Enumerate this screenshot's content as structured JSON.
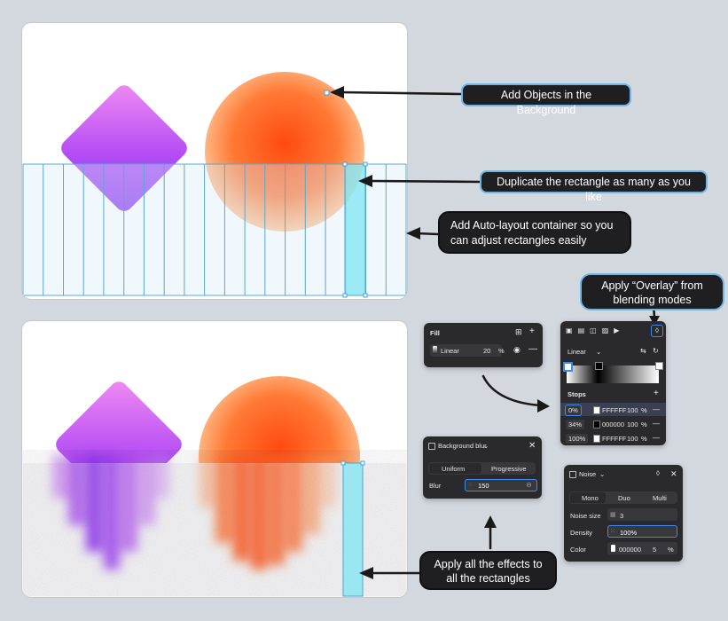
{
  "callouts": {
    "add_objects": "Add Objects in the Background",
    "duplicate": "Duplicate the rectangle as many as you like",
    "auto_layout": "Add Auto-layout container so you can adjust rectangles easily",
    "overlay": "Apply “Overlay” from blending modes",
    "apply_effects": "Apply all the effects to all the rectangles"
  },
  "fill_panel": {
    "title": "Fill",
    "type": "Linear",
    "opacity": "20",
    "unit": "%"
  },
  "gradient_panel": {
    "type": "Linear",
    "stops_title": "Stops",
    "stops": [
      {
        "pos": "0%",
        "hex": "FFFFFF",
        "opacity": "100",
        "unit": "%",
        "swatch": "#ffffff"
      },
      {
        "pos": "34%",
        "hex": "000000",
        "opacity": "100",
        "unit": "%",
        "swatch": "#000000"
      },
      {
        "pos": "100%",
        "hex": "FFFFFF",
        "opacity": "100",
        "unit": "%",
        "swatch": "#ffffff"
      }
    ]
  },
  "blur_panel": {
    "title": "Background blur",
    "tab_uniform": "Uniform",
    "tab_progressive": "Progressive",
    "label": "Blur",
    "value": "150"
  },
  "noise_panel": {
    "title": "Noise",
    "tabs": [
      "Mono",
      "Duo",
      "Multi"
    ],
    "size_label": "Noise size",
    "size_value": "3",
    "density_label": "Density",
    "density_value": "100%",
    "color_label": "Color",
    "color_hex": "000000",
    "color_opacity": "5",
    "color_unit": "%"
  },
  "colors": {
    "background": "#d3d7de",
    "callout_fill": "#1f1f22",
    "callout_border": "#6db6e6",
    "panel_fill": "#2a2a2d",
    "accent_blue": "#3d8bf2",
    "selection_cyan": "#7fe6f2",
    "guide_blue": "#5aa9cf",
    "diamond_purple": "#b44cf5",
    "sphere_orange": "#ff5a1f"
  }
}
